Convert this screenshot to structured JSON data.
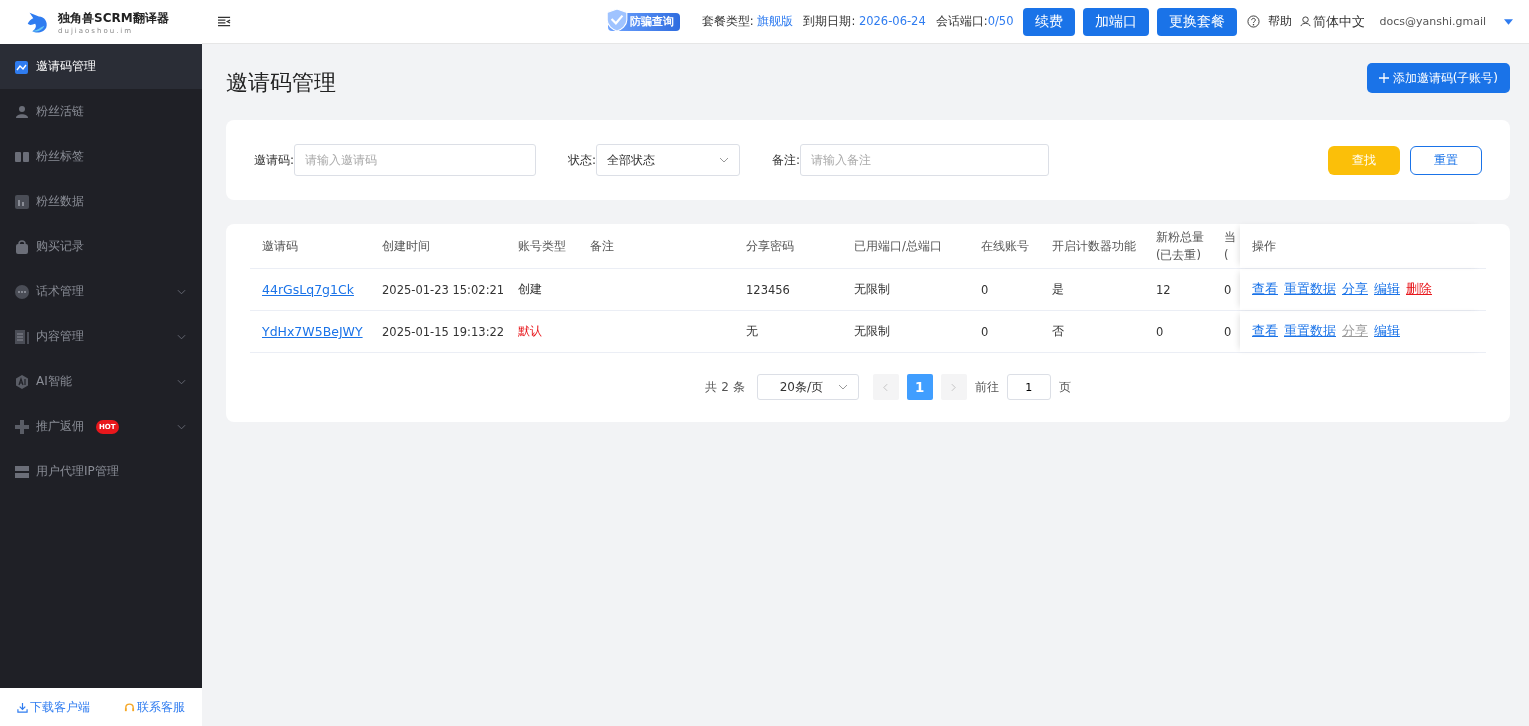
{
  "brand": {
    "name": "独角兽SCRM翻译器",
    "domain": "dujiaoshou.im"
  },
  "header": {
    "badge": "防骗查询",
    "plan_label": "套餐类型:",
    "plan_value": "旗舰版",
    "expiry_label": "到期日期:",
    "expiry_value": "2026-06-24",
    "ports_label": "会话端口:",
    "ports_value": "0/50",
    "buttons": [
      "续费",
      "加端口",
      "更换套餐"
    ],
    "help": "帮助",
    "language": "简体中文",
    "account": "docs@yanshi.gmail"
  },
  "sidebar": {
    "items": [
      {
        "label": "邀请码管理",
        "selected": true,
        "submenu": false
      },
      {
        "label": "粉丝活链",
        "selected": false,
        "submenu": false
      },
      {
        "label": "粉丝标签",
        "selected": false,
        "submenu": false
      },
      {
        "label": "粉丝数据",
        "selected": false,
        "submenu": false
      },
      {
        "label": "购买记录",
        "selected": false,
        "submenu": false
      },
      {
        "label": "话术管理",
        "selected": false,
        "submenu": true
      },
      {
        "label": "内容管理",
        "selected": false,
        "submenu": true
      },
      {
        "label": "AI智能",
        "selected": false,
        "submenu": true
      },
      {
        "label": "推广返佣",
        "selected": false,
        "submenu": true,
        "badge": "HOT"
      },
      {
        "label": "用户代理IP管理",
        "selected": false,
        "submenu": false
      }
    ],
    "footer": [
      "下载客户端",
      "联系客服"
    ]
  },
  "page": {
    "title": "邀请码管理",
    "add_button": "添加邀请码(子账号)"
  },
  "filters": {
    "code_label": "邀请码:",
    "code_placeholder": "请输入邀请码",
    "status_label": "状态:",
    "status_value": "全部状态",
    "note_label": "备注:",
    "note_placeholder": "请输入备注",
    "search_button": "查找",
    "reset_button": "重置"
  },
  "table": {
    "columns": [
      [
        "邀请码"
      ],
      [
        "创建时间"
      ],
      [
        "账号类型"
      ],
      [
        "备注"
      ],
      [
        "分享密码"
      ],
      [
        "已用端口/总端口"
      ],
      [
        "在线账号"
      ],
      [
        "开启计数器功能"
      ],
      [
        "新粉总量",
        "(已去重)"
      ],
      [
        "当",
        "("
      ],
      [
        "操作"
      ]
    ],
    "rows": [
      {
        "code": "44rGsLq7g1Ck",
        "created": "2025-01-23 15:02:21",
        "type": "创建",
        "type_alert": false,
        "note": "",
        "password": "123456",
        "ports": "无限制",
        "online": "0",
        "counter": "是",
        "fans": "12",
        "column_10": "0",
        "actions": [
          {
            "label": "查看",
            "kind": "link",
            "disabled": false
          },
          {
            "label": "重置数据",
            "kind": "link",
            "disabled": false
          },
          {
            "label": "分享",
            "kind": "link",
            "disabled": false
          },
          {
            "label": "编辑",
            "kind": "link",
            "disabled": false
          },
          {
            "label": "删除",
            "kind": "danger",
            "disabled": false
          }
        ]
      },
      {
        "code": "YdHx7W5BeJWY",
        "created": "2025-01-15 19:13:22",
        "type": "默认",
        "type_alert": true,
        "note": "",
        "password": "无",
        "ports": "无限制",
        "online": "0",
        "counter": "否",
        "fans": "0",
        "column_10": "0",
        "actions": [
          {
            "label": "查看",
            "kind": "link",
            "disabled": false
          },
          {
            "label": "重置数据",
            "kind": "link",
            "disabled": false
          },
          {
            "label": "分享",
            "kind": "link",
            "disabled": true
          },
          {
            "label": "编辑",
            "kind": "link",
            "disabled": false
          }
        ]
      }
    ]
  },
  "pagination": {
    "total": "共 2 条",
    "page_size": "20条/页",
    "pages": [
      {
        "label": "1",
        "selected": true
      }
    ],
    "goto_label": "前往",
    "goto_value": "1",
    "page_suffix": "页"
  }
}
